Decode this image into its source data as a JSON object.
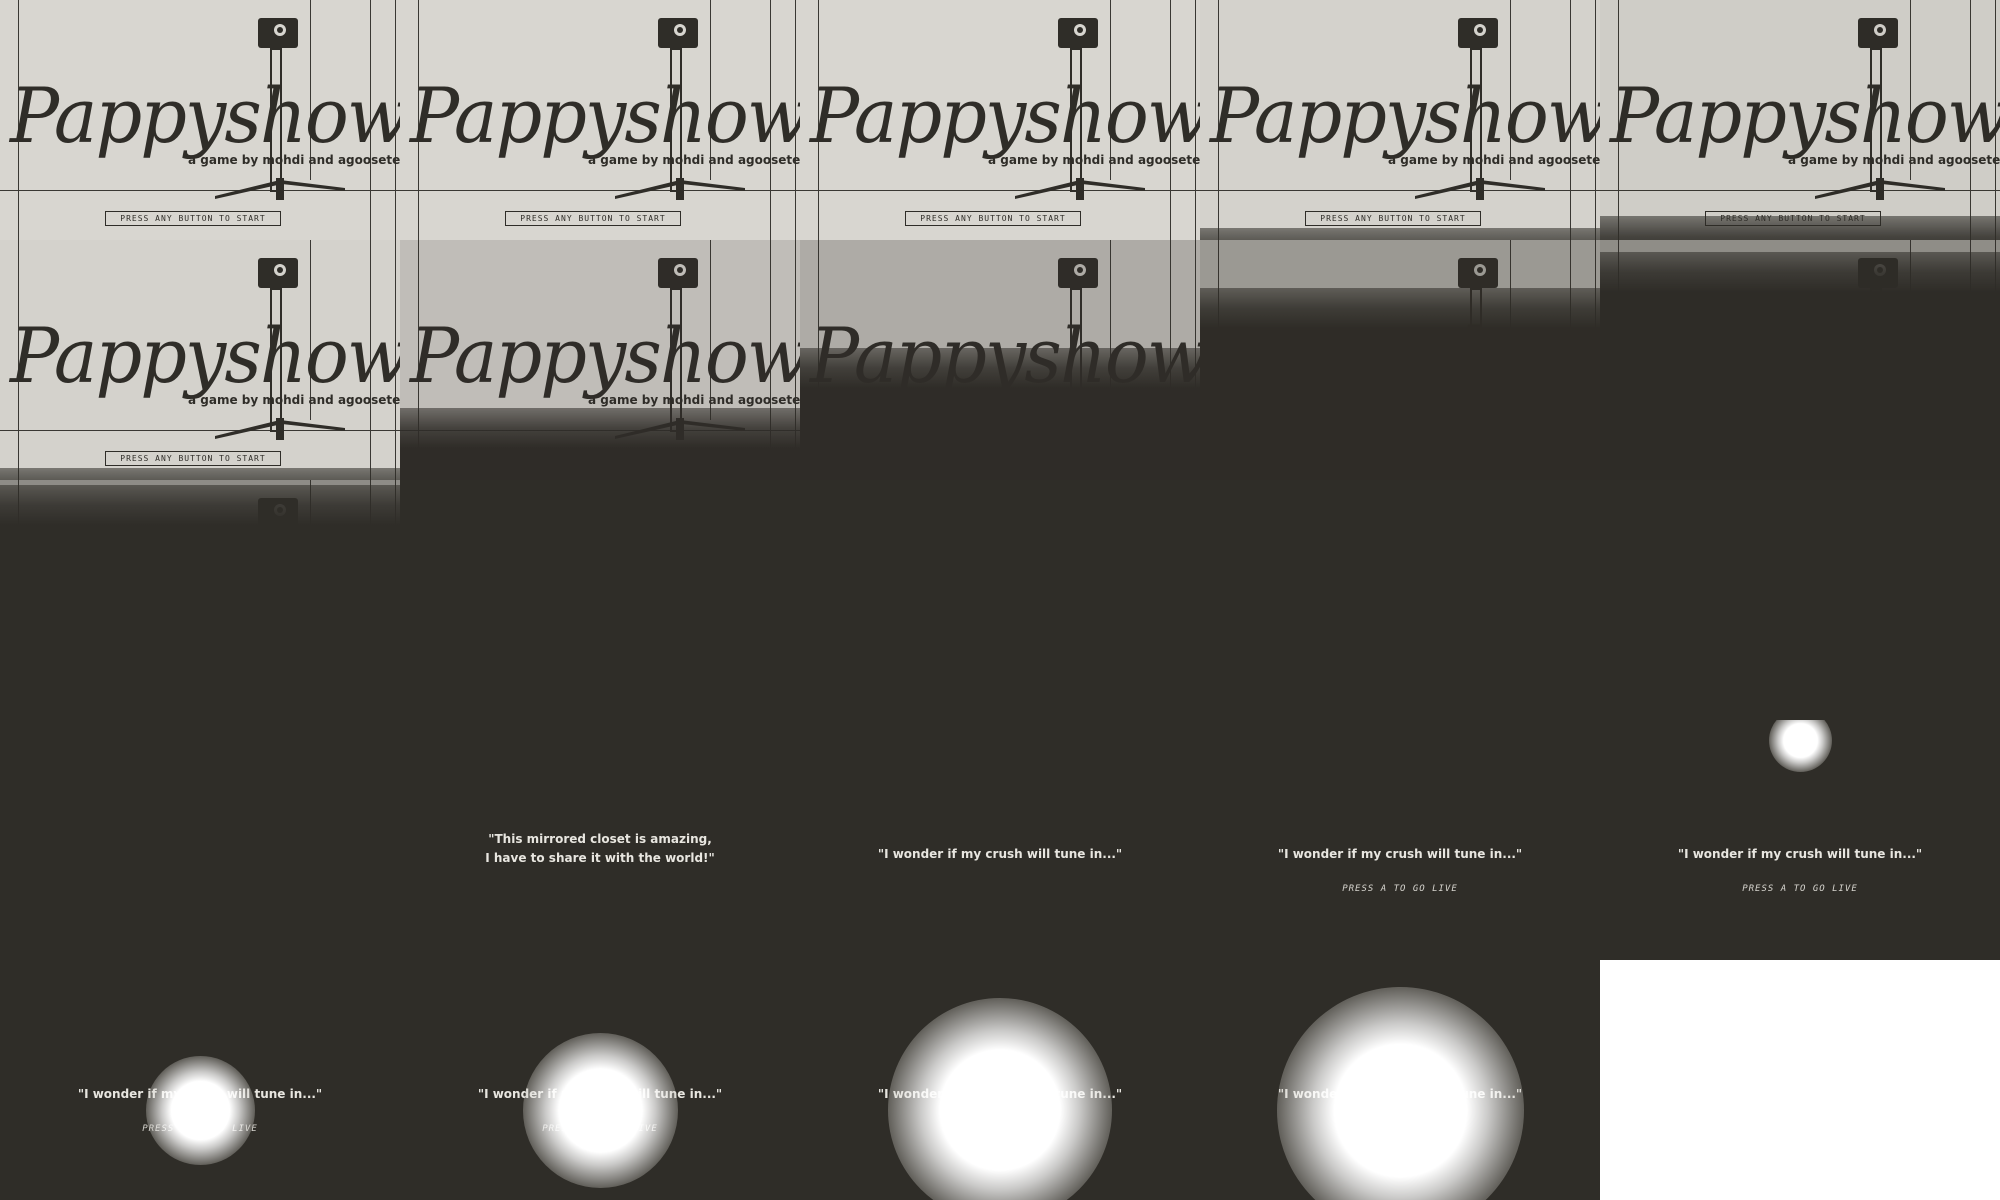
{
  "game": {
    "title": "Pappyshow",
    "credit": "a game by mohdi and agooseteen",
    "start_prompt": "PRESS ANY BUTTON TO START"
  },
  "dialogue": {
    "line_mirror": "\"This mirrored closet is amazing,\n I have to share it with the world!\"",
    "line_crush": "\"I wonder if my crush will tune in...\"",
    "go_live_prompt": "PRESS A TO GO LIVE"
  },
  "frames": [
    {
      "kind": "title",
      "fade": 0.0
    },
    {
      "kind": "title",
      "fade": 0.0
    },
    {
      "kind": "title",
      "fade": 0.0
    },
    {
      "kind": "title",
      "fade": 0.05
    },
    {
      "kind": "title",
      "fade": 0.1
    },
    {
      "kind": "title",
      "fade": 0.05
    },
    {
      "kind": "title",
      "fade": 0.3
    },
    {
      "kind": "title",
      "fade": 0.55
    },
    {
      "kind": "title",
      "fade": 0.8
    },
    {
      "kind": "title",
      "fade": 0.95
    },
    {
      "kind": "title",
      "fade": 0.98
    },
    {
      "kind": "dark"
    },
    {
      "kind": "dark"
    },
    {
      "kind": "dark"
    },
    {
      "kind": "dark"
    },
    {
      "kind": "dark"
    },
    {
      "kind": "dialogue",
      "line": "mirror"
    },
    {
      "kind": "dialogue",
      "line": "crush"
    },
    {
      "kind": "dialogue",
      "line": "crush",
      "prompt": true
    },
    {
      "kind": "dialogue",
      "line": "crush",
      "prompt": true,
      "glow": 0.1
    },
    {
      "kind": "dialogue",
      "line": "crush",
      "prompt": true,
      "glow": 0.3
    },
    {
      "kind": "dialogue",
      "line": "crush",
      "prompt": true,
      "glow": 0.5
    },
    {
      "kind": "dialogue",
      "line": "crush",
      "prompt": true,
      "glow": 0.8
    },
    {
      "kind": "dialogue",
      "line": "crush",
      "prompt": true,
      "glow": 0.9
    },
    {
      "kind": "white"
    }
  ],
  "colors": {
    "paper": "#d8d6d0",
    "ink": "#2f2d28",
    "light_text": "#e8e6e0",
    "flash": "#ffffff"
  }
}
